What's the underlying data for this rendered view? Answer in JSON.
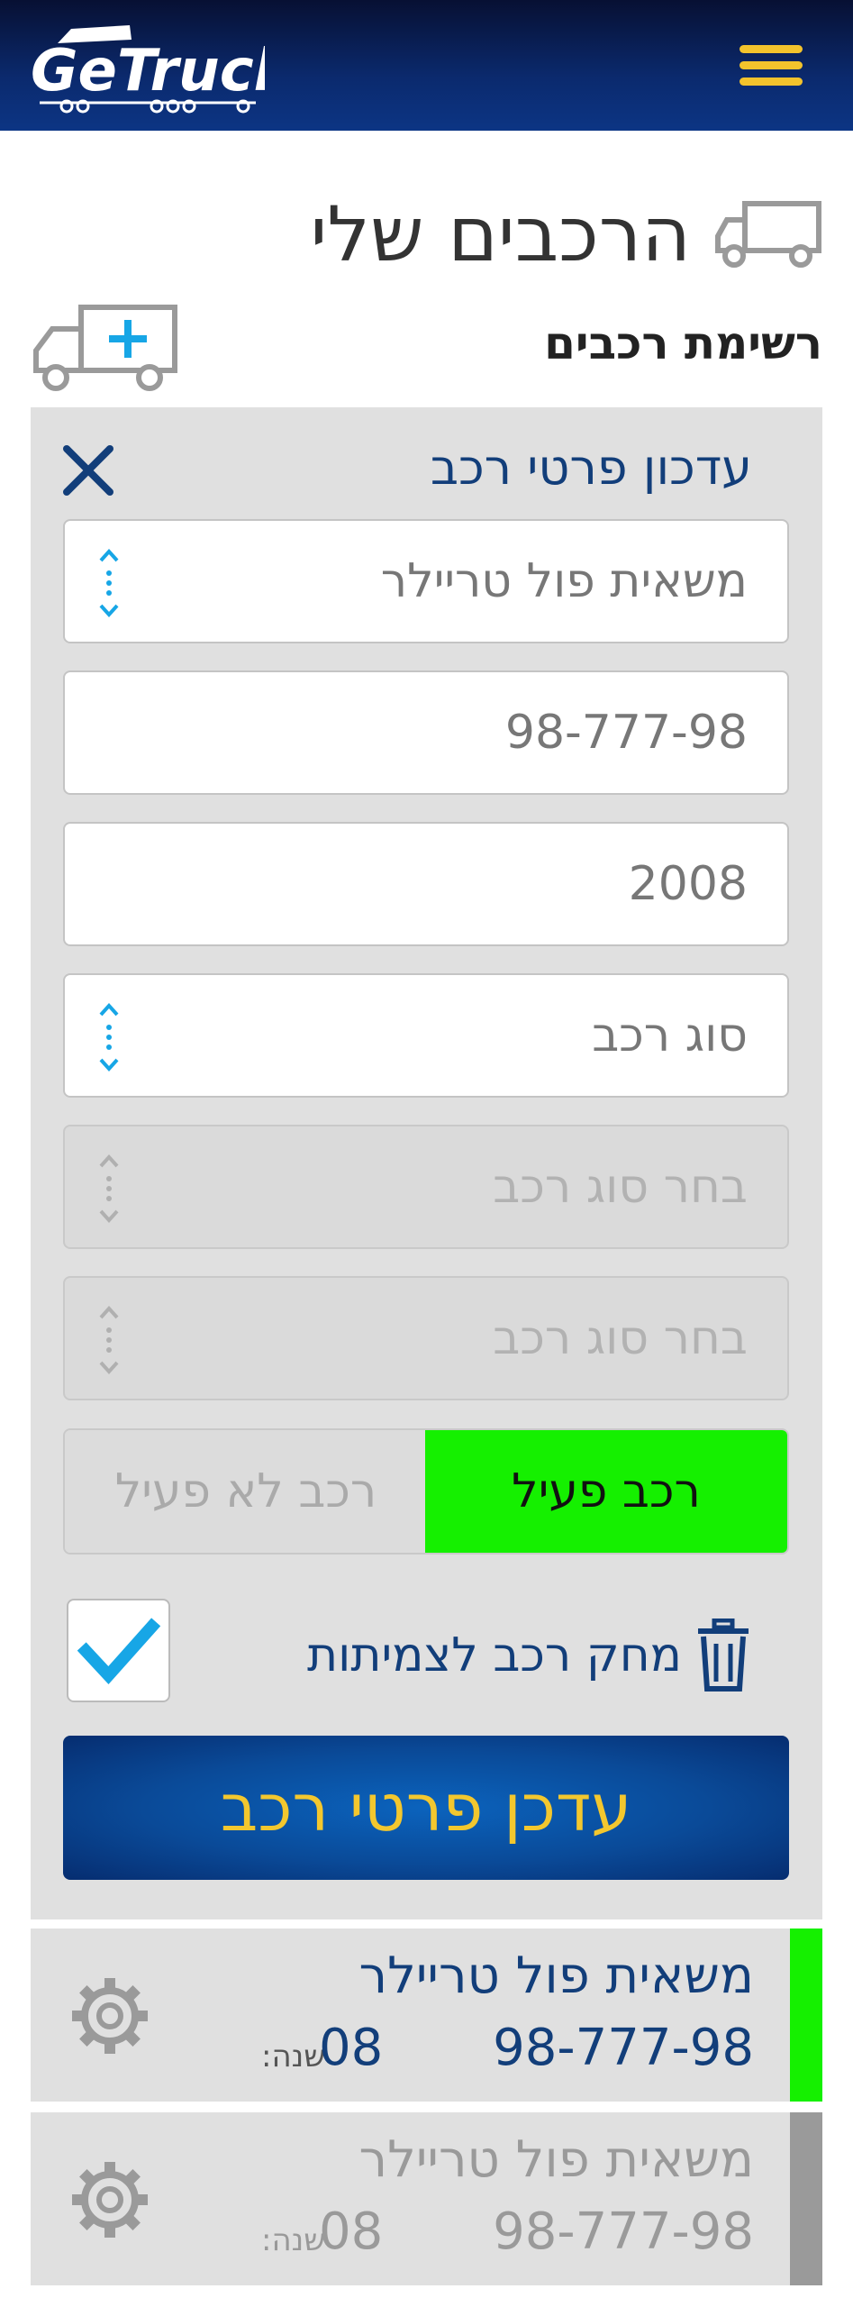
{
  "header": {
    "logo_text": "GeTruck",
    "colors": {
      "background": "#0b2a6e",
      "menu": "#f3c32c"
    }
  },
  "page": {
    "title": "הרכבים שלי",
    "list_heading": "רשימת רכבים"
  },
  "form": {
    "title": "עדכון פרטי רכב",
    "fields": [
      {
        "value": "משאית פול טריילר",
        "type": "select"
      },
      {
        "value": "98-777-98",
        "type": "text"
      },
      {
        "value": "2008",
        "type": "text"
      },
      {
        "value": "סוג רכב",
        "type": "select"
      },
      {
        "value": "בחר סוג רכב",
        "type": "select",
        "disabled": true
      },
      {
        "value": "בחר סוג רכב",
        "type": "select",
        "disabled": true
      }
    ],
    "status_toggle": {
      "active_label": "רכב פעיל",
      "inactive_label": "רכב לא פעיל",
      "selected": "active",
      "active_color": "#15f000"
    },
    "delete_label": "מחק רכב לצמיתות",
    "delete_checked": true,
    "submit_label": "עדכן פרטי רכב"
  },
  "vehicles": [
    {
      "name": "משאית פול טריילר",
      "plate": "98-777-98",
      "year_label": "שנה:",
      "year": "08",
      "active": true,
      "status_color": "#15f000"
    },
    {
      "name": "משאית פול טריילר",
      "plate": "98-777-98",
      "year_label": "שנה:",
      "year": "08",
      "active": false,
      "status_color": "#9a9a9a"
    }
  ]
}
